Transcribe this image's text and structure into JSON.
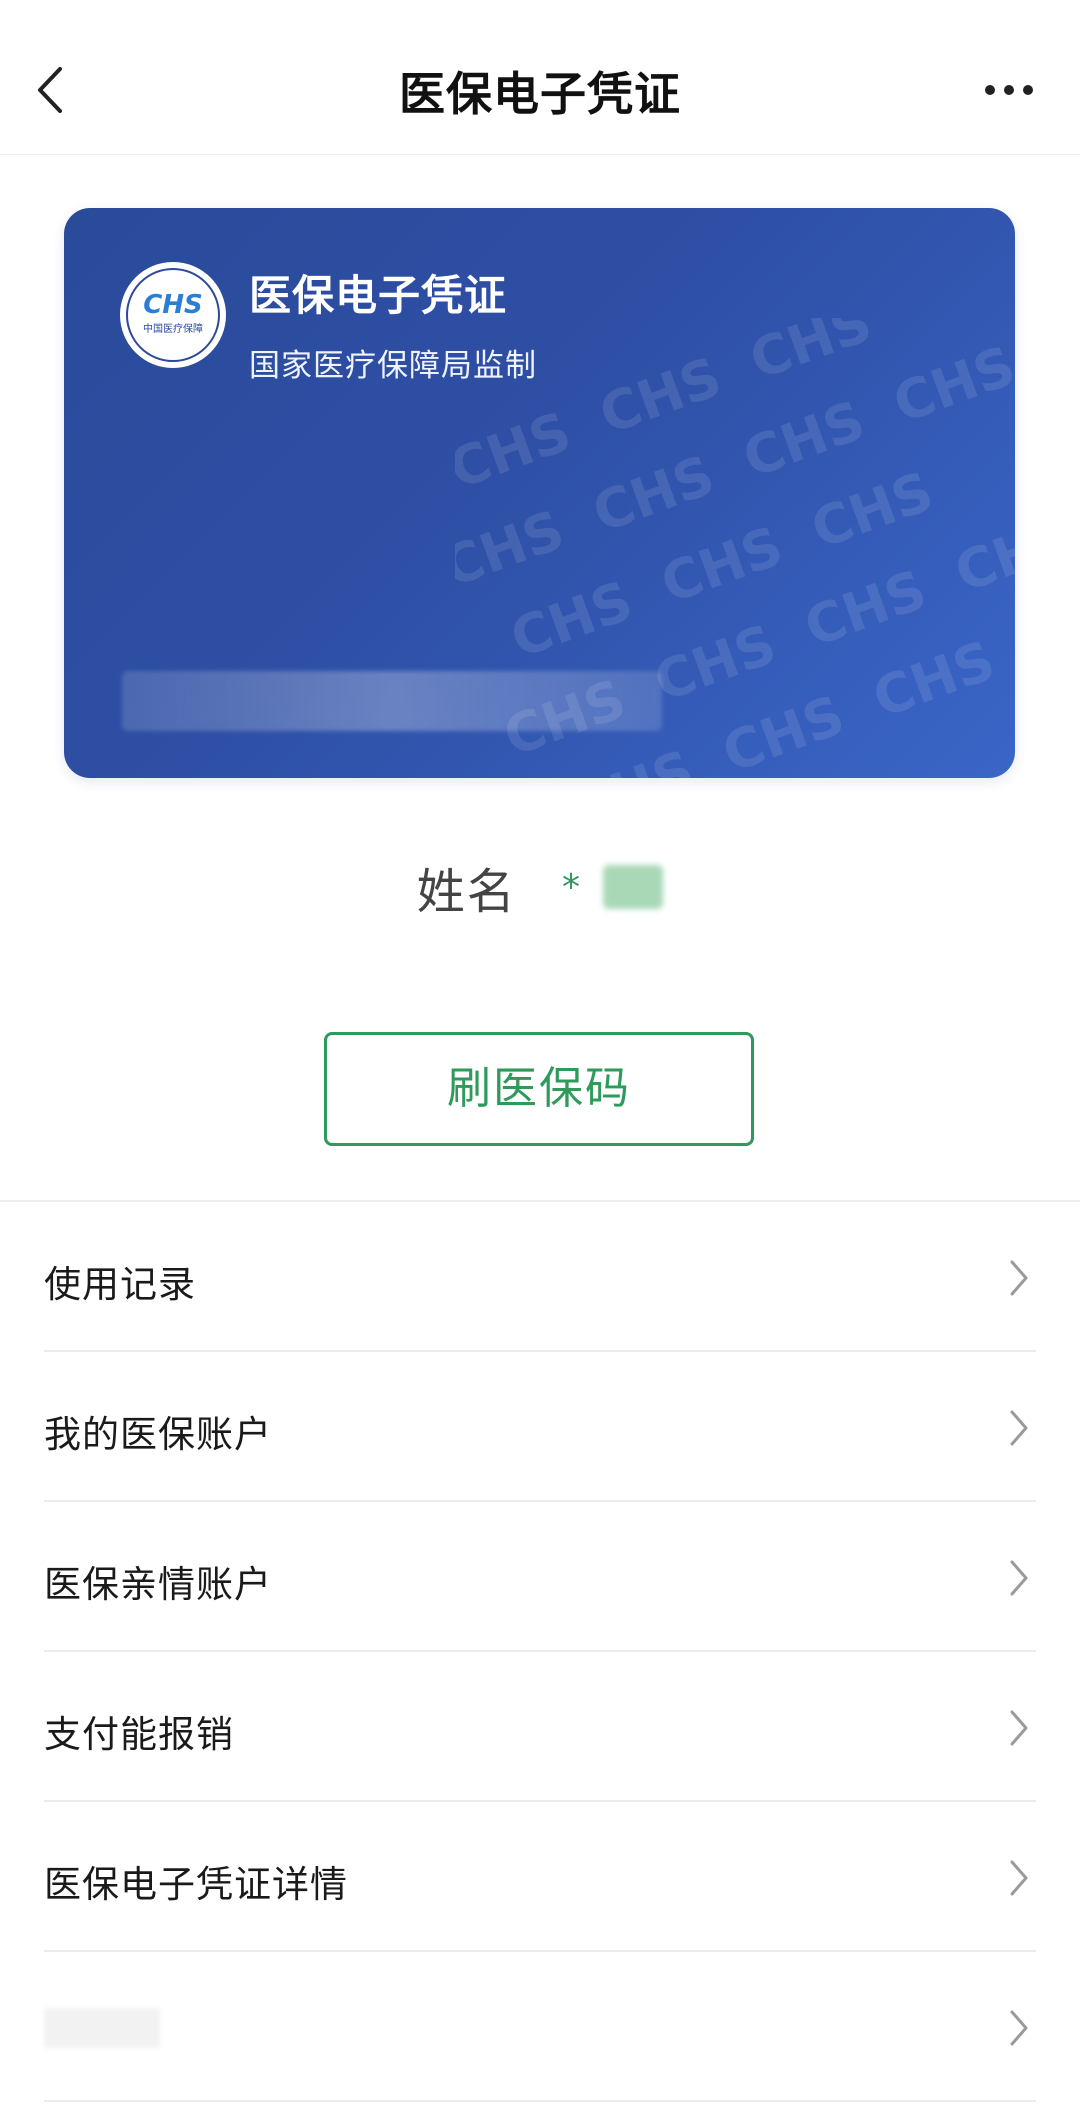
{
  "header": {
    "title": "医保电子凭证"
  },
  "card": {
    "title": "医保电子凭证",
    "subtitle": "国家医疗保障局监制",
    "logo_text": "CHS",
    "logo_subtext": "中国医疗保障"
  },
  "profile": {
    "name_label": "姓名",
    "name_value": "*"
  },
  "actions": {
    "scan_label": "刷医保码"
  },
  "menu": {
    "items": [
      {
        "label": "使用记录"
      },
      {
        "label": "我的医保账户"
      },
      {
        "label": "医保亲情账户"
      },
      {
        "label": "支付能报销"
      },
      {
        "label": "医保电子凭证详情"
      },
      {
        "label": ""
      }
    ]
  },
  "colors": {
    "accent": "#2e9a5b",
    "card_blue": "#2e4fa5"
  },
  "icons": {
    "back": "chevron-left-icon",
    "more": "more-horizontal-icon",
    "row_arrow": "chevron-right-icon"
  }
}
